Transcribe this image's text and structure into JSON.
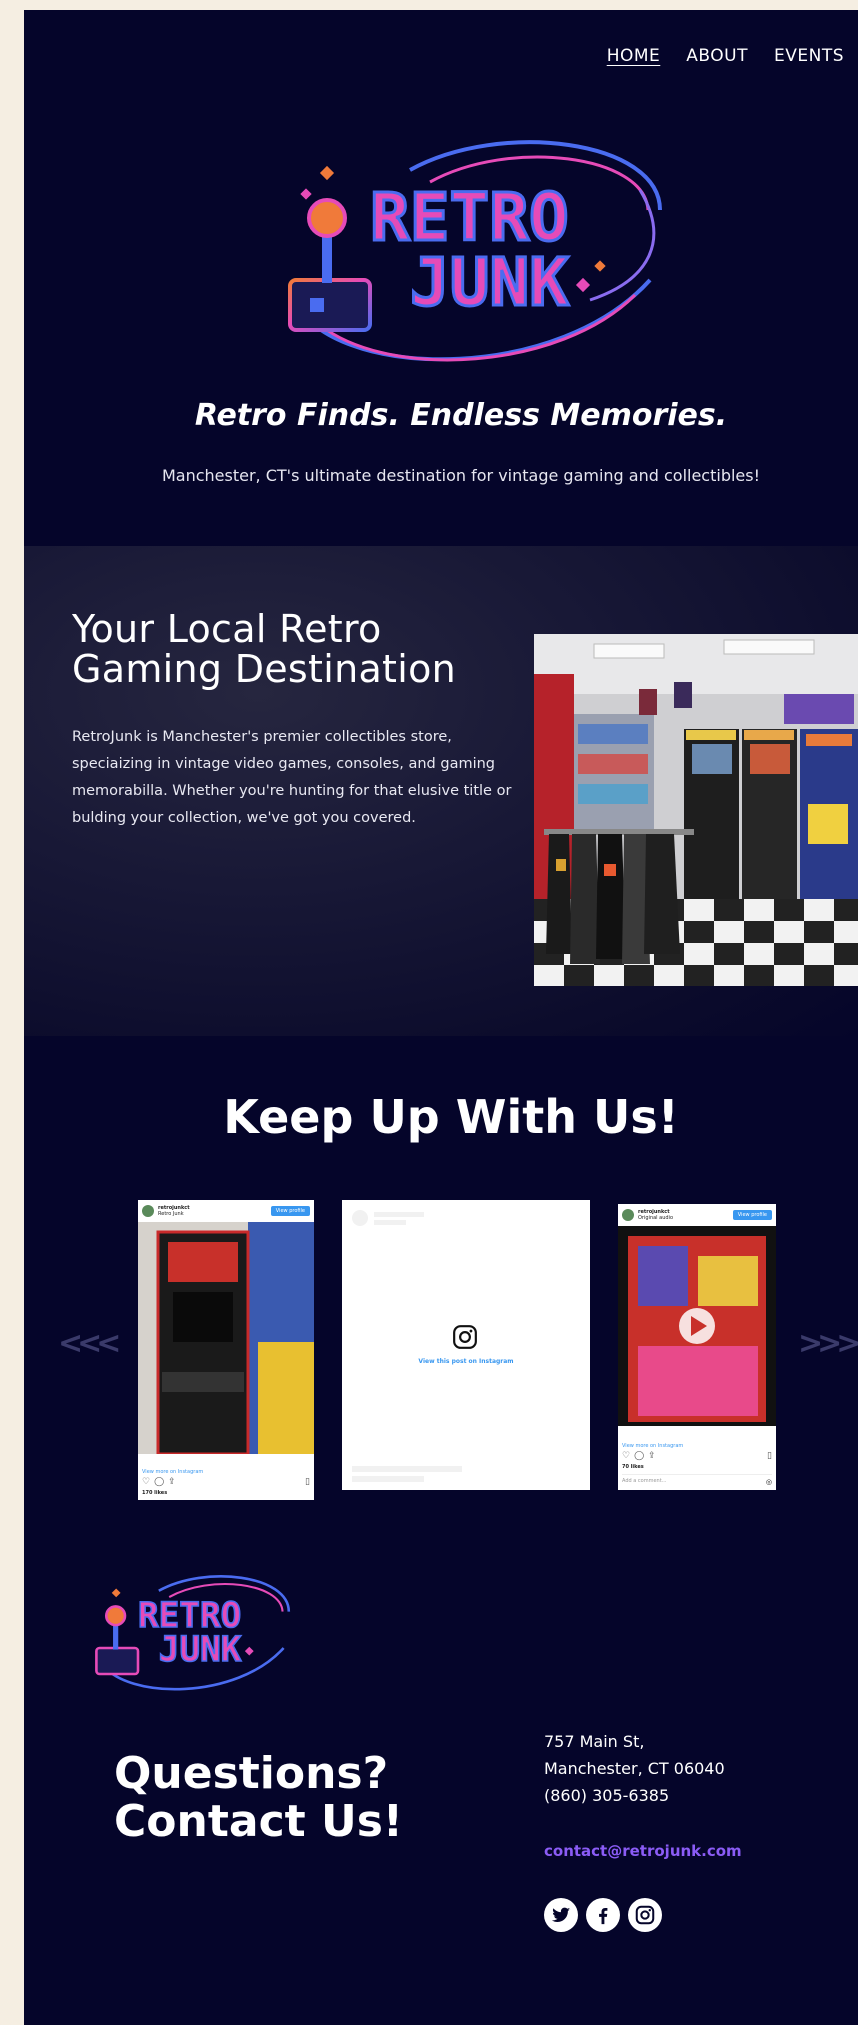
{
  "nav": {
    "items": [
      {
        "label": "HOME",
        "active": true
      },
      {
        "label": "ABOUT",
        "active": false
      },
      {
        "label": "EVENTS",
        "active": false
      }
    ]
  },
  "hero": {
    "logo_text_line1": "RETRO",
    "logo_text_line2": "JUNK",
    "tagline": "Retro Finds. Endless Memories.",
    "subtagline": "Manchester, CT's ultimate destination for vintage gaming and collectibles!"
  },
  "about": {
    "heading": "Your Local Retro Gaming Destination",
    "body": "RetroJunk is Manchester's premier collectibles store, speciaizing in vintage video games, consoles, and gaming memorabilla. Whether you're hunting for that elusive title or bulding your collection, we've got you covered.",
    "photo_icon": "store-interior-photo"
  },
  "social": {
    "heading": "Keep Up With Us!",
    "prev_arrow": "<<<",
    "next_arrow": ">>>",
    "posts": [
      {
        "username": "retrojunkct",
        "subtitle": "Retro Junk",
        "button": "View profile",
        "link": "View more on Instagram",
        "likes": "170 likes"
      },
      {
        "link": "View this post on Instagram"
      },
      {
        "username": "retrojunkct",
        "subtitle": "Original audio",
        "button": "View profile",
        "link": "View more on Instagram",
        "likes": "70 likes",
        "comment_placeholder": "Add a comment..."
      }
    ]
  },
  "footer": {
    "logo_text_line1": "RETRO",
    "logo_text_line2": "JUNK",
    "contact_heading": "Questions? Contact Us!",
    "address_line1": "757 Main St,",
    "address_line2": "Manchester, CT 06040",
    "phone": "(860) 305-6385",
    "email": "contact@retrojunk.com",
    "social_icons": [
      "twitter-icon",
      "facebook-icon",
      "instagram-icon"
    ]
  },
  "colors": {
    "page_bg": "#05052a",
    "outer_bg": "#f5eee2",
    "email": "#8b5cf6",
    "logo_pink": "#e64bb8",
    "logo_orange": "#f07a3a",
    "logo_blue": "#4a6cf0"
  }
}
